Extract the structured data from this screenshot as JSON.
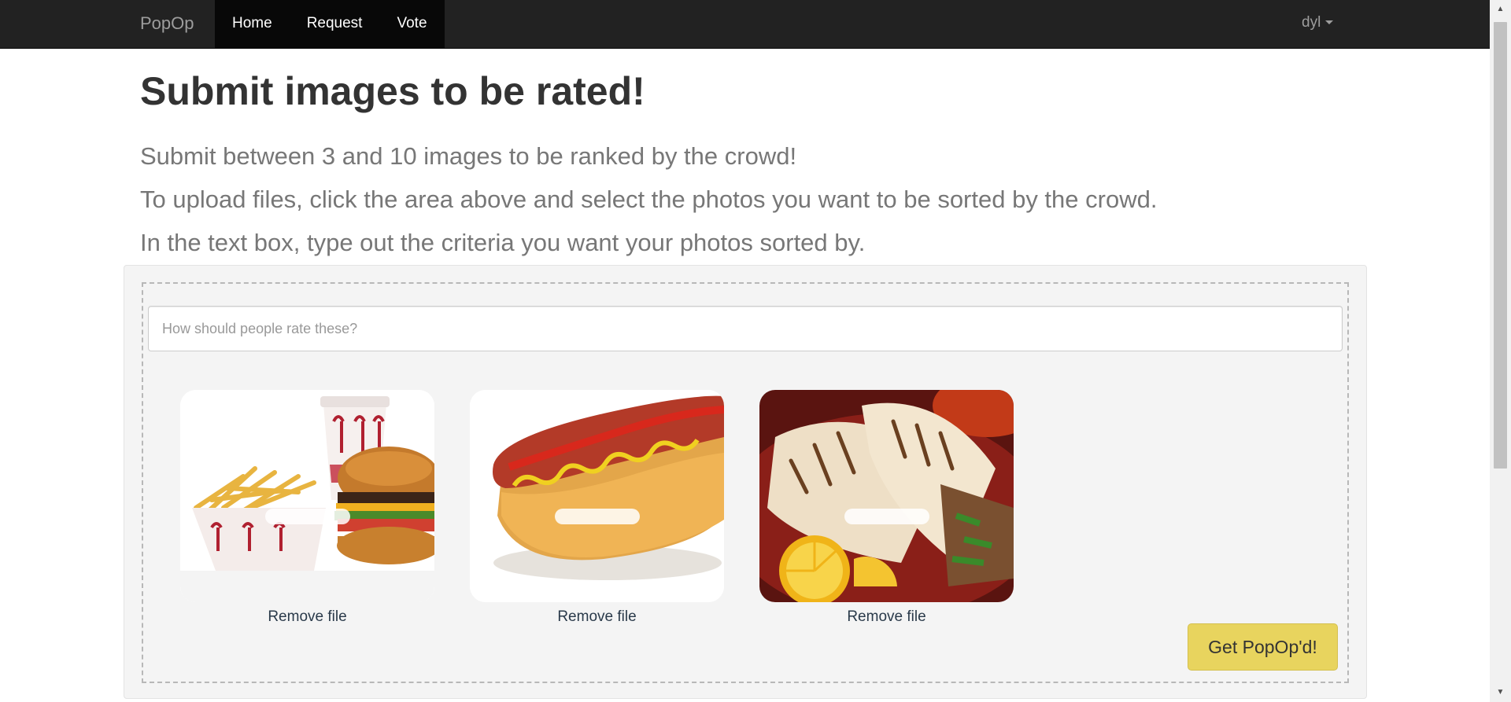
{
  "navbar": {
    "brand": "PopOp",
    "links": [
      {
        "label": "Home"
      },
      {
        "label": "Request"
      },
      {
        "label": "Vote"
      }
    ],
    "user": "dyl"
  },
  "main": {
    "title": "Submit images to be rated!",
    "lead_lines": [
      "Submit between 3 and 10 images to be ranked by the crowd!",
      "To upload files, click the area above and select the photos you want to be sorted by the crowd.",
      "In the text box, type out the criteria you want your photos sorted by."
    ],
    "criteria_placeholder": "How should people rate these?",
    "previews": [
      {
        "image": "burger-fries-drink-image",
        "remove_label": "Remove file"
      },
      {
        "image": "hotdog-image",
        "remove_label": "Remove file"
      },
      {
        "image": "wraps-image",
        "remove_label": "Remove file"
      }
    ],
    "submit_label": "Get PopOp'd!"
  },
  "colors": {
    "navbar_bg": "#222222",
    "submit_bg": "#e8d45e",
    "well_bg": "#f4f4f4"
  }
}
